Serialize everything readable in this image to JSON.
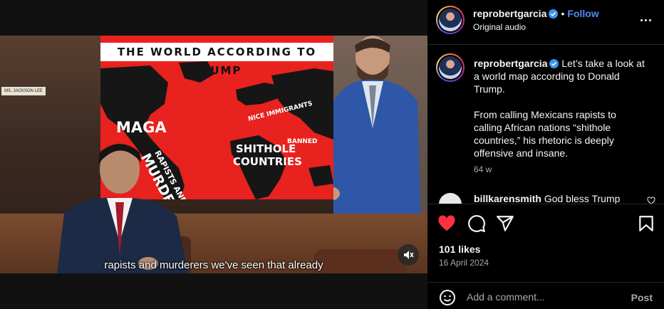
{
  "video": {
    "poster_title": "THE WORLD ACCORDING TO TRUMP",
    "map_labels": {
      "maga": "MAGA",
      "rapists_and": "RAPISTS AND",
      "murderers": "MURDERERS",
      "nice_immigrants": "NICE IMMIGRANTS",
      "banned": "BANNED",
      "shithole": "SHITHOLE",
      "countries": "COUNTRIES"
    },
    "nameplate": "MS. JACKSON LEE",
    "subtitle": "rapists and murderers we've seen that already",
    "mute_icon": "speaker-muted-icon"
  },
  "header": {
    "username": "reprobertgarcia",
    "separator": "•",
    "follow_label": "Follow",
    "audio_label": "Original audio"
  },
  "caption": {
    "username": "reprobertgarcia",
    "line1": "Let’s take a look at a world map according to Donald Trump.",
    "line2": "From calling Mexicans rapists to calling African nations “shithole countries,” his rhetoric is deeply offensive and insane.",
    "time": "64 w"
  },
  "comment": {
    "username": "billkarensmith",
    "text": "God bless Trump"
  },
  "actions": {
    "like_color": "#ff3040",
    "likes": "101 likes",
    "date": "16 April 2024"
  },
  "add_comment": {
    "placeholder": "Add a comment...",
    "post_label": "Post"
  },
  "colors": {
    "accent": "#4f8cf7",
    "poster_red": "#e8221e",
    "verified": "#3897f0"
  }
}
